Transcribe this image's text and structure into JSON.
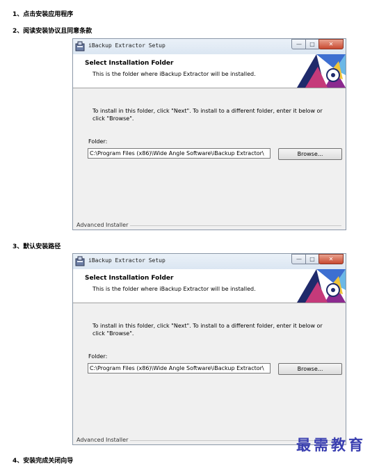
{
  "steps": [
    "1、点击安装应用程序",
    "2、阅读安装协议且同意条款",
    "3、默认安装路径",
    "4、安装完成关闭向导"
  ],
  "dialog": {
    "title": "iBackup Extractor Setup",
    "controls": {
      "minimize": "—",
      "maximize": "□",
      "close": "✕"
    },
    "heading": "Select Installation Folder",
    "subheading": "This is the folder where iBackup Extractor will be installed.",
    "info": "To install in this folder, click \"Next\". To install to a different folder, enter it below or click \"Browse\".",
    "folder_label": "Folder:",
    "folder_value": "C:\\Program Files (x86)\\Wide Angle Software\\iBackup Extractor\\",
    "browse_label": "Browse...",
    "footer": "Advanced Installer"
  },
  "watermark": "最需教育"
}
